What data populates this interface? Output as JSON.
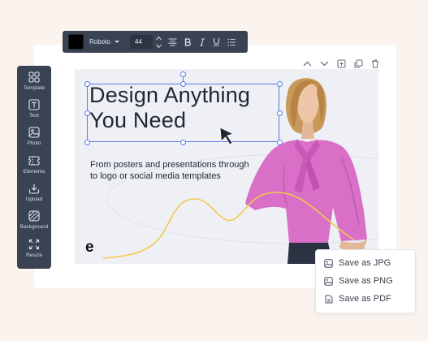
{
  "toolbar": {
    "text_color": "#000000",
    "font_family_value": "Roboto",
    "font_size_value": "44",
    "icons": [
      "align-center-icon",
      "bold-icon",
      "italic-icon",
      "underline-icon",
      "list-icon"
    ]
  },
  "board_actions": [
    "chevron-up-icon",
    "chevron-down-icon",
    "add-page-icon",
    "duplicate-icon",
    "trash-icon"
  ],
  "sidebar": {
    "items": [
      {
        "label": "Template",
        "icon": "grid-icon"
      },
      {
        "label": "Text",
        "icon": "text-icon"
      },
      {
        "label": "Photo",
        "icon": "image-icon"
      },
      {
        "label": "Elements",
        "icon": "elements-icon"
      },
      {
        "label": "Upload",
        "icon": "upload-icon"
      },
      {
        "label": "Background",
        "icon": "background-icon"
      },
      {
        "label": "Resize",
        "icon": "resize-icon"
      }
    ]
  },
  "canvas": {
    "headline_line1": "Design Anything",
    "headline_line2": "You Need",
    "subtitle": "From posters and presentations through to logo or social media templates",
    "logo_text": "e",
    "accent_color": "#f2c94c",
    "selection_color": "#5b7be6"
  },
  "export_menu": {
    "items": [
      {
        "label": "Save as JPG",
        "icon": "image-icon"
      },
      {
        "label": "Save as PNG",
        "icon": "image-icon"
      },
      {
        "label": "Save as PDF",
        "icon": "file-icon"
      }
    ]
  },
  "colors": {
    "page_background": "#fbf4ee",
    "panel_dark": "#3a4354",
    "text_dark": "#1f2633"
  }
}
